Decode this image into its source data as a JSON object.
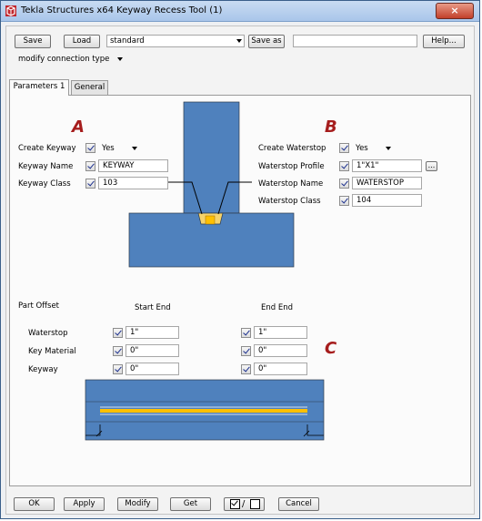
{
  "window": {
    "title": "Tekla Structures x64  Keyway Recess Tool (1)",
    "close_glyph": "×"
  },
  "toolbar": {
    "save_label": "Save",
    "load_label": "Load",
    "preset_value": "standard",
    "save_as_label": "Save as",
    "save_as_value": "",
    "help_label": "Help...",
    "mode_value": "modify connection type"
  },
  "tabs": [
    {
      "label": "Parameters 1",
      "active": true
    },
    {
      "label": "General",
      "active": false
    }
  ],
  "markers": {
    "a": "A",
    "b": "B",
    "c": "C"
  },
  "keyway": {
    "create_label": "Create Keyway",
    "create_value": "Yes",
    "name_label": "Keyway Name",
    "name_value": "KEYWAY",
    "class_label": "Keyway Class",
    "class_value": "103"
  },
  "waterstop": {
    "create_label": "Create Waterstop",
    "create_value": "Yes",
    "profile_label": "Waterstop Profile",
    "profile_value": "1\"X1\"",
    "browse_label": "...",
    "name_label": "Waterstop Name",
    "name_value": "WATERSTOP",
    "class_label": "Waterstop Class",
    "class_value": "104"
  },
  "offset": {
    "title": "Part Offset",
    "start_header": "Start End",
    "end_header": "End End",
    "rows": [
      {
        "label": "Waterstop",
        "start": "1\"",
        "end": "1\""
      },
      {
        "label": "Key Material",
        "start": "0\"",
        "end": "0\""
      },
      {
        "label": "Keyway",
        "start": "0\"",
        "end": "0\""
      }
    ]
  },
  "footer": {
    "ok_label": "OK",
    "apply_label": "Apply",
    "modify_label": "Modify",
    "get_label": "Get",
    "toggle_label": "/",
    "cancel_label": "Cancel"
  },
  "colors": {
    "concrete": "#4f81bd",
    "waterstop": "#ffc000",
    "marker": "#a61d1d"
  }
}
